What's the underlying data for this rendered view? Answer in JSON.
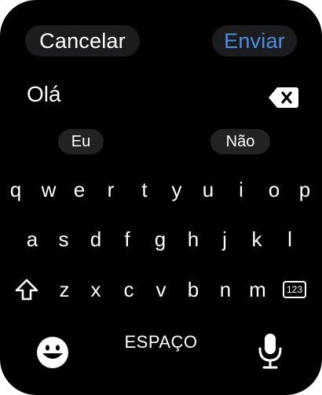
{
  "header": {
    "cancel_label": "Cancelar",
    "send_label": "Enviar"
  },
  "input": {
    "value": "Olá"
  },
  "suggestions": [
    "Eu",
    "Não"
  ],
  "keyboard": {
    "row1": [
      "q",
      "w",
      "e",
      "r",
      "t",
      "y",
      "u",
      "i",
      "o",
      "p"
    ],
    "row2": [
      "a",
      "s",
      "d",
      "f",
      "g",
      "h",
      "j",
      "k",
      "l"
    ],
    "row3": [
      "z",
      "x",
      "c",
      "v",
      "b",
      "n",
      "m"
    ],
    "numbers_label": "123",
    "space_label": "ESPAÇO"
  },
  "icons": {
    "backspace": "backspace-icon",
    "shift": "shift-icon",
    "emoji": "emoji-icon",
    "mic": "microphone-icon"
  },
  "colors": {
    "accent": "#4a90e2",
    "background": "#000000",
    "pill": "#1c1c1e"
  }
}
